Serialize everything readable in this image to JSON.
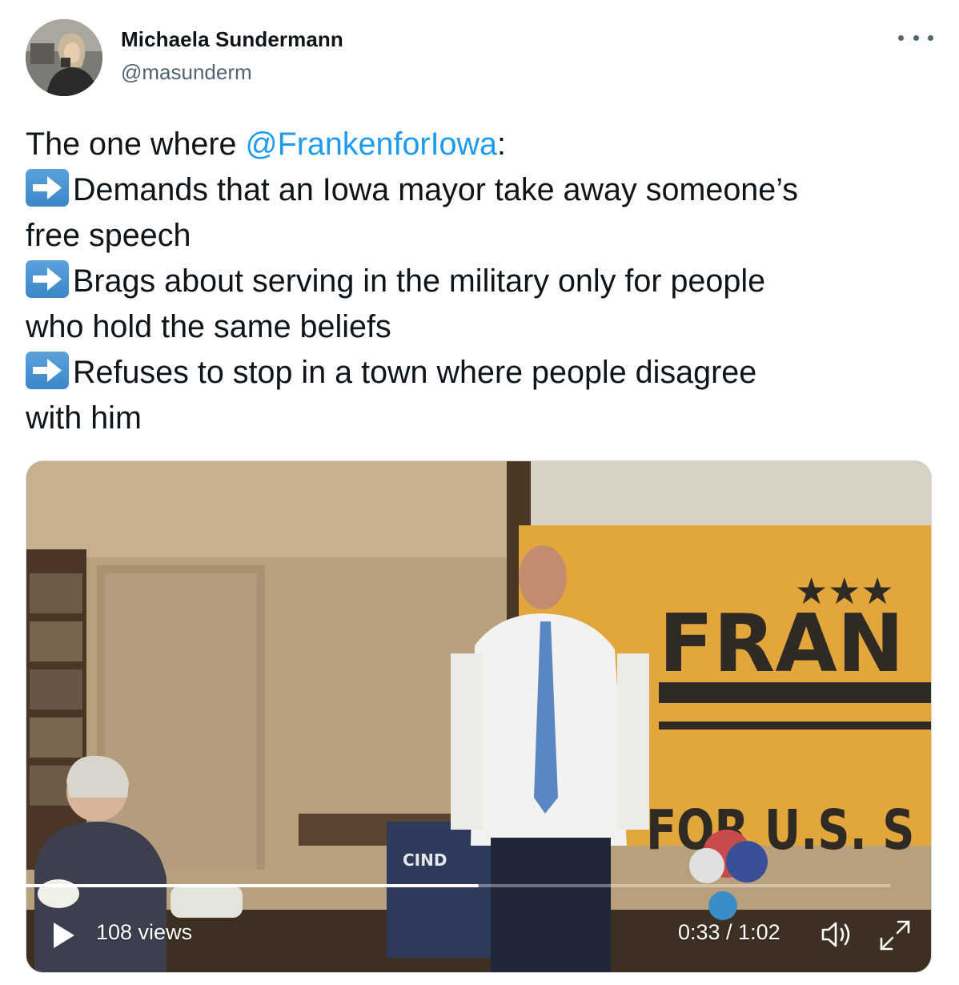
{
  "author": {
    "name": "Michaela Sundermann",
    "handle": "@masunderm",
    "avatar": "profile-photo"
  },
  "more_icon": "more-horizontal-icon",
  "tweet": {
    "intro_before": "The one where ",
    "mention": "@FrankenforIowa",
    "intro_after": ":",
    "bullet_icon": "right-arrow-emoji",
    "bullets": [
      {
        "line1": "Demands that an Iowa mayor take away someone’s",
        "line2": "free speech"
      },
      {
        "line1": "Brags about serving in the military only for people",
        "line2": "who hold the same beliefs"
      },
      {
        "line1": "Refuses to stop in a town where people disagree",
        "line2": "with him"
      }
    ]
  },
  "video": {
    "views": "108 views",
    "time": "0:33 / 1:02",
    "progress": 0.53,
    "play_icon": "play-icon",
    "volume_icon": "volume-icon",
    "fullscreen_icon": "fullscreen-icon",
    "banner_text_1": "FRAN",
    "banner_text_2": "FOR U.S. S",
    "sign_text": "CIND",
    "colors": {
      "banner": "#e3a53c",
      "wall": "#b59b74",
      "accent_link": "#1d9bf0"
    }
  }
}
